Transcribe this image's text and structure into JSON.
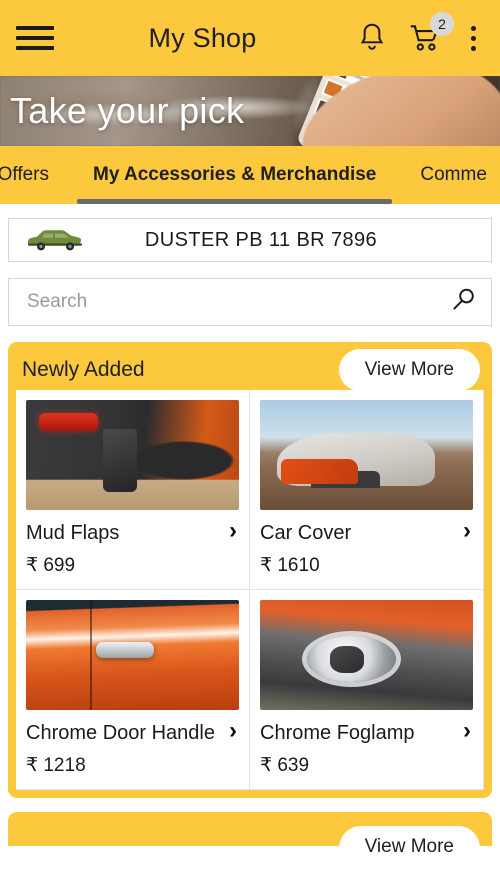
{
  "header": {
    "title": "My Shop",
    "menu_icon": "hamburger-menu-icon",
    "notification_icon": "bell-icon",
    "cart_icon": "shopping-cart-icon",
    "cart_badge": "2",
    "overflow_icon": "kebab-menu-icon",
    "background_color": "#FCC83D"
  },
  "banner": {
    "headline": "Take your pick"
  },
  "tabs": [
    {
      "label": "r Offers",
      "active": false
    },
    {
      "label": "My Accessories & Merchandise",
      "active": true
    },
    {
      "label": "Comme",
      "active": false
    }
  ],
  "vehicle": {
    "icon": "car-icon",
    "label": "DUSTER PB 11 BR 7896"
  },
  "search": {
    "value": "",
    "placeholder": "Search",
    "icon": "search-icon"
  },
  "newly_added": {
    "title": "Newly Added",
    "view_more_label": "View More",
    "products": [
      {
        "name": "Mud Flaps",
        "price": "₹ 699",
        "image": "mud-flaps-photo",
        "chevron": "›"
      },
      {
        "name": "Car Cover",
        "price": "₹ 1610",
        "image": "car-cover-photo",
        "chevron": "›"
      },
      {
        "name": "Chrome Door Handle",
        "price": "₹ 1218",
        "image": "chrome-door-handle-photo",
        "chevron": "›"
      },
      {
        "name": "Chrome Foglamp",
        "price": "₹ 639",
        "image": "chrome-foglamp-photo",
        "chevron": "›"
      }
    ]
  },
  "next_section": {
    "view_more_label": "View More"
  }
}
